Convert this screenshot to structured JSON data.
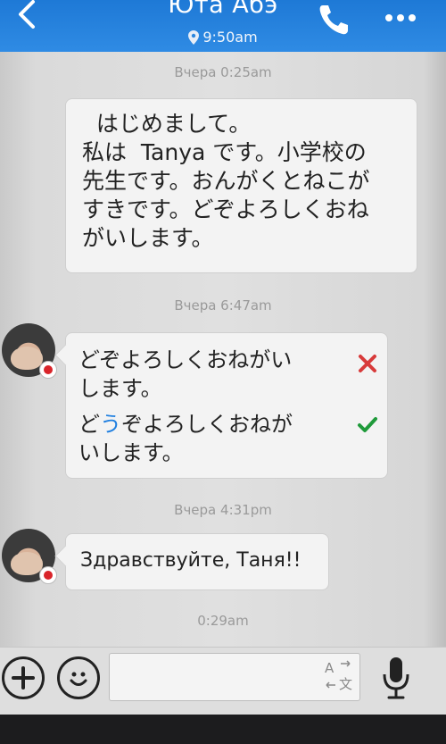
{
  "header": {
    "title": "Юта Абэ",
    "local_time": "9:50am"
  },
  "messages": {
    "ts1": "Вчера 0:25am",
    "out_lines": [
      "  はじめまして。",
      "私は  Tanya です。小学校の",
      "先生です。おんがくとねこが",
      "すきです。どぞよろしくおね",
      "がいします。"
    ],
    "ts2": "Вчера 6:47am",
    "wrong_lines": [
      "どぞよろしくおねがい",
      "します。"
    ],
    "fixed_prefix": "ど",
    "fixed_insert": "う",
    "fixed_rest": "ぞよろしくおねが",
    "fixed_line2": "いします。",
    "ts3": "Вчера 4:31pm",
    "greeting": "Здравствуйте, Таня!!",
    "ts4": "0:29am"
  },
  "composer": {
    "input_value": "",
    "placeholder": "",
    "translate_label_top": "A",
    "translate_label_bottom": "文"
  },
  "colors": {
    "header_blue": "#2b86df",
    "wrong_red": "#d83a3a",
    "right_green": "#1f9a3a",
    "accent_blue": "#1f7fe0"
  }
}
